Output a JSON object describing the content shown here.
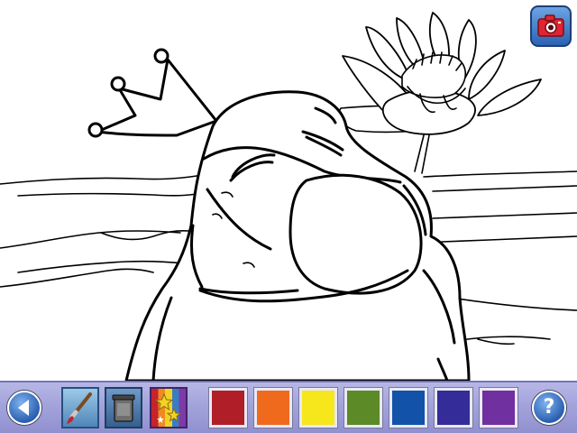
{
  "toolbar": {
    "help_label": "?",
    "palette": [
      {
        "name": "red",
        "color": "#b01e28"
      },
      {
        "name": "orange",
        "color": "#f06a1e"
      },
      {
        "name": "yellow",
        "color": "#f6e61c"
      },
      {
        "name": "green",
        "color": "#5b8a26"
      },
      {
        "name": "blue",
        "color": "#1252a8"
      },
      {
        "name": "indigo",
        "color": "#342c98"
      },
      {
        "name": "purple",
        "color": "#7030a0"
      }
    ]
  },
  "icons": {
    "back": "left-arrow-icon",
    "brush": "paintbrush-icon",
    "bucket": "paint-bucket-icon",
    "stickers": "stars-icon",
    "camera": "camera-icon",
    "help": "question-mark-icon"
  },
  "colors": {
    "toolbar_background": "#a3a3dc",
    "button_blue": "#2a5fb0",
    "camera_lens": "#d11e2a"
  }
}
